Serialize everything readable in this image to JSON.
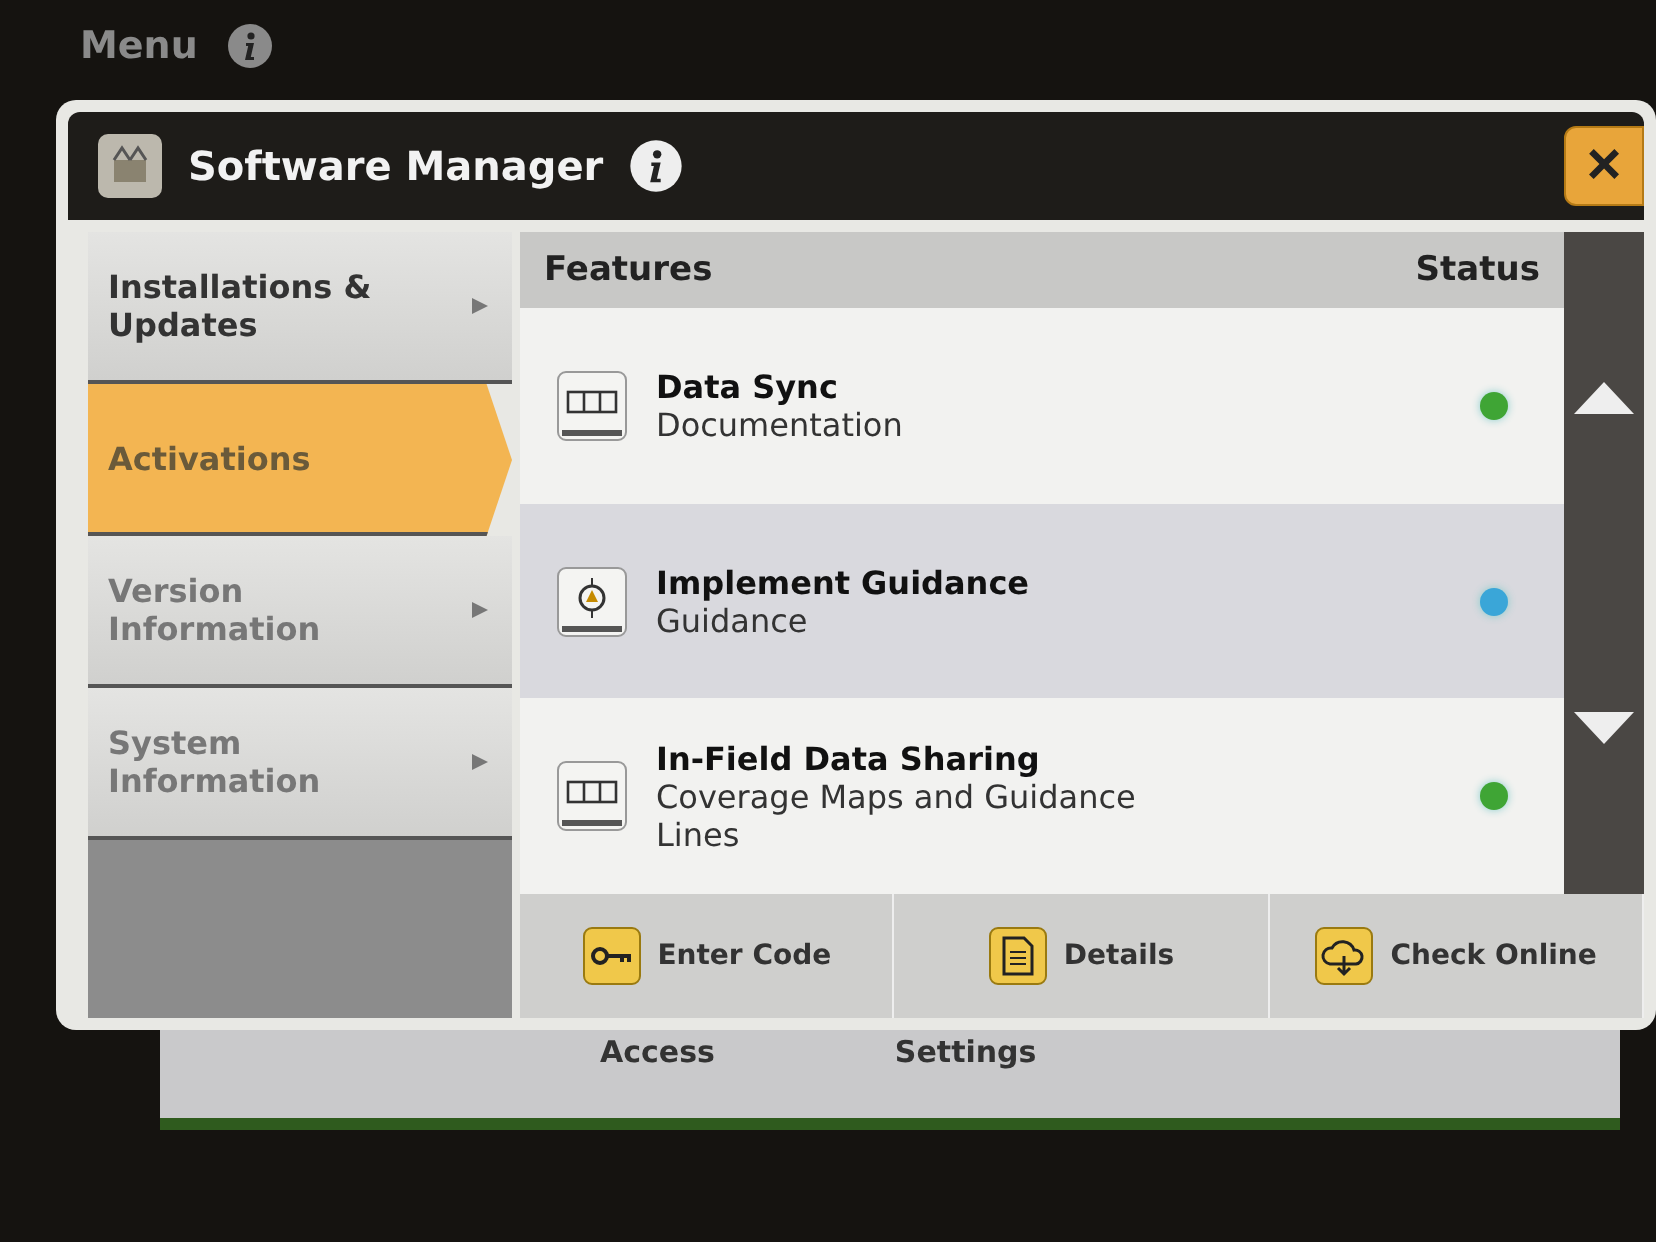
{
  "top_bar": {
    "title": "Menu"
  },
  "window": {
    "title": "Software Manager",
    "close": "×"
  },
  "sidebar": {
    "items": [
      {
        "label": "Installations & Updates",
        "selected": false
      },
      {
        "label": "Activations",
        "selected": true
      },
      {
        "label": "Version Information",
        "selected": false
      },
      {
        "label": "System Information",
        "selected": false
      }
    ]
  },
  "table": {
    "columns": [
      "Features",
      "Status"
    ],
    "rows": [
      {
        "name": "Data Sync",
        "category": "Documentation",
        "color": "#3fa535"
      },
      {
        "name": "Implement Guidance",
        "category": "Guidance",
        "color": "#3aa6d8"
      },
      {
        "name": "In-Field Data Sharing",
        "category": "Coverage Maps and Guidance Lines",
        "color": "#3fa535"
      }
    ]
  },
  "buttons": [
    {
      "label": "Enter Code"
    },
    {
      "label": "Details"
    },
    {
      "label": "Check Online"
    }
  ],
  "background_tabs": [
    "Access",
    "Settings"
  ]
}
